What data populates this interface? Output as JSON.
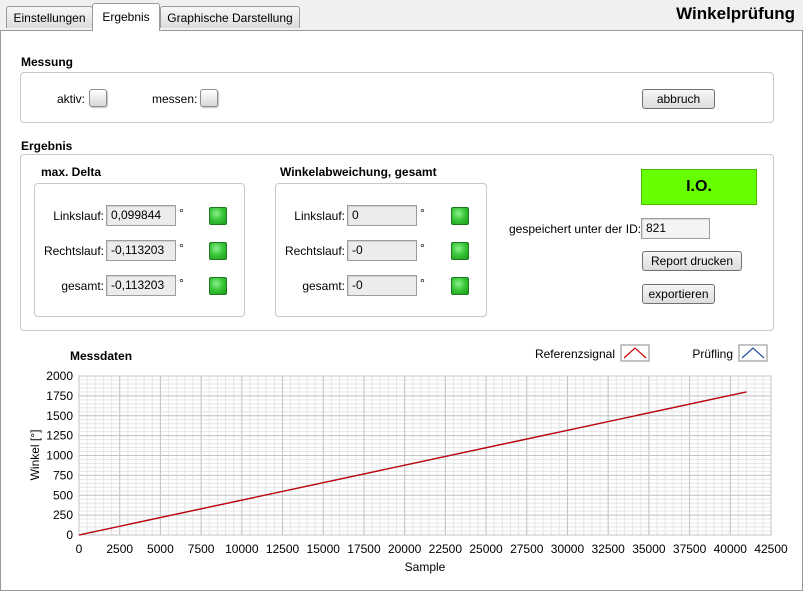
{
  "app": {
    "title": "Winkelprüfung"
  },
  "tabs": [
    {
      "label": "Einstellungen"
    },
    {
      "label": "Ergebnis"
    },
    {
      "label": "Graphische Darstellung"
    }
  ],
  "messung": {
    "title": "Messung",
    "aktiv_label": "aktiv:",
    "messen_label": "messen:",
    "abbruch_label": "abbruch"
  },
  "ergebnis": {
    "title": "Ergebnis",
    "max_delta": {
      "title": "max. Delta",
      "rows": [
        {
          "label": "Linkslauf:",
          "value": "0,099844",
          "unit": "°"
        },
        {
          "label": "Rechtslauf:",
          "value": "-0,113203",
          "unit": "°"
        },
        {
          "label": "gesamt:",
          "value": "-0,113203",
          "unit": "°"
        }
      ]
    },
    "winkel": {
      "title": "Winkelabweichung, gesamt",
      "rows": [
        {
          "label": "Linkslauf:",
          "value": "0",
          "unit": "°"
        },
        {
          "label": "Rechtslauf:",
          "value": "-0",
          "unit": "°"
        },
        {
          "label": "gesamt:",
          "value": "-0",
          "unit": "°"
        }
      ]
    },
    "status": "I.O.",
    "id_label": "gespeichert unter der ID:",
    "id_value": "821",
    "report_label": "Report drucken",
    "export_label": "exportieren"
  },
  "colors": {
    "status_ok": "#66ff00",
    "led_ok": "#36c436",
    "ref": "#cc0000",
    "pruefling": "#1f4f9f"
  },
  "chart_data": {
    "type": "line",
    "title": "Messdaten",
    "xlabel": "Sample",
    "ylabel": "Winkel [°]",
    "xlim": [
      0,
      42500
    ],
    "ylim": [
      0,
      2000
    ],
    "xticks": [
      0,
      2500,
      5000,
      7500,
      10000,
      12500,
      15000,
      17500,
      20000,
      22500,
      25000,
      27500,
      30000,
      32500,
      35000,
      37500,
      40000,
      42500
    ],
    "yticks": [
      0,
      250,
      500,
      750,
      1000,
      1250,
      1500,
      1750,
      2000
    ],
    "grid": true,
    "legend_placement": "top-right",
    "series": [
      {
        "name": "Referenzsignal",
        "x": [
          0,
          41000
        ],
        "y": [
          0,
          1800
        ],
        "color": "#cc0000"
      },
      {
        "name": "Prüfling",
        "x": [
          0,
          41000
        ],
        "y": [
          0,
          1800
        ],
        "color": "#1f4f9f"
      }
    ]
  }
}
